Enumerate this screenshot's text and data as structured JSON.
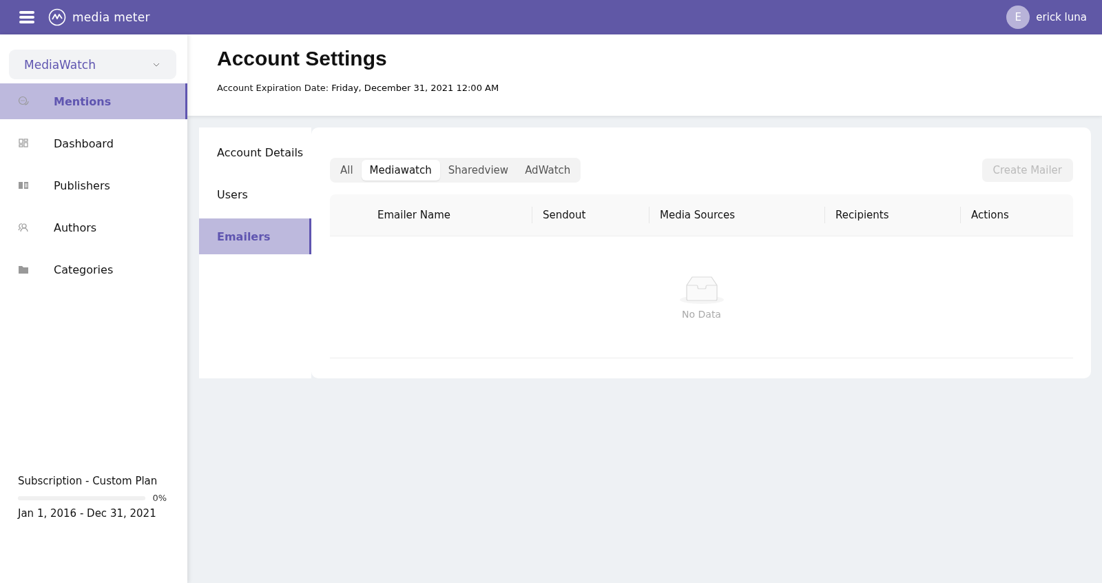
{
  "top_bar": {
    "brand": "media meter",
    "user": {
      "initial": "E",
      "name": "erick luna"
    }
  },
  "sidebar": {
    "product_select": {
      "value": "MediaWatch"
    },
    "items": [
      {
        "label": "Mentions",
        "selected": true
      },
      {
        "label": "Dashboard",
        "selected": false
      },
      {
        "label": "Publishers",
        "selected": false
      },
      {
        "label": "Authors",
        "selected": false
      },
      {
        "label": "Categories",
        "selected": false
      }
    ],
    "subscription": {
      "plan": "Subscription - Custom Plan",
      "level": 0,
      "percent": "0%",
      "period": "Jan 1, 2016 - Dec 31, 2021"
    }
  },
  "header": {
    "title": "Account Settings",
    "expiration_label": "Account Expiration Date:",
    "expiration_value": "Friday, December 31, 2021 12:00 AM"
  },
  "settings_nav": [
    {
      "label": "Account Details",
      "selected": false
    },
    {
      "label": "Users",
      "selected": false
    },
    {
      "label": "Emailers",
      "selected": true
    }
  ],
  "filter_tabs": [
    {
      "label": "All",
      "selected": false
    },
    {
      "label": "Mediawatch",
      "selected": true
    },
    {
      "label": "Sharedview",
      "selected": false
    },
    {
      "label": "AdWatch",
      "selected": false
    }
  ],
  "create_button": {
    "label": "Create Mailer",
    "disabled": true
  },
  "table": {
    "columns": [
      "Emailer Name",
      "Sendout",
      "Media Sources",
      "Recipients",
      "Actions"
    ],
    "empty_text": "No Data"
  }
}
